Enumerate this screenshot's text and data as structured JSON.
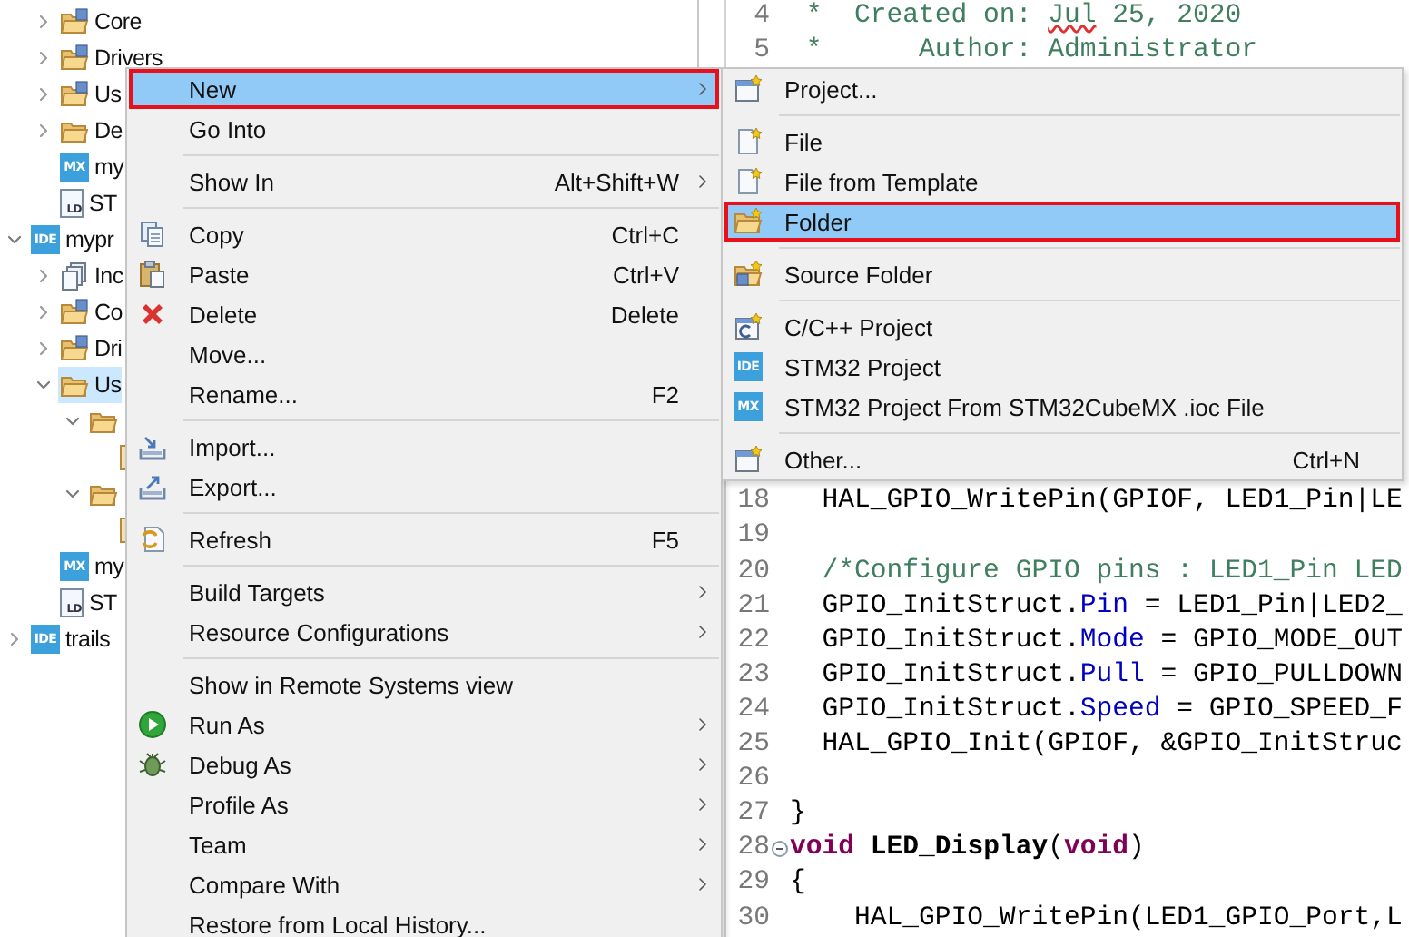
{
  "explorer": {
    "tree": [
      {
        "kind": "group",
        "children": [
          {
            "label": "Core",
            "kind": "source-folder",
            "expanded": false,
            "selected": false
          },
          {
            "label": "Drivers",
            "kind": "source-folder",
            "expanded": false,
            "selected": false
          },
          {
            "label": "Us",
            "kind": "source-folder",
            "expanded": false,
            "selected": false
          },
          {
            "label": "De",
            "kind": "folder",
            "expanded": false,
            "selected": false
          },
          {
            "label": "my",
            "kind": "badge-file",
            "badge": "MX",
            "selected": false
          },
          {
            "label": "ST",
            "kind": "linker-file",
            "badge": "LD",
            "selected": false
          }
        ]
      },
      {
        "label": "mypr",
        "kind": "project",
        "badge": "IDE",
        "expanded": true,
        "selected": false,
        "children": [
          {
            "label": "Inc",
            "kind": "include",
            "expanded": false,
            "selected": false
          },
          {
            "label": "Co",
            "kind": "source-folder",
            "expanded": false,
            "selected": false
          },
          {
            "label": "Dri",
            "kind": "source-folder",
            "expanded": false,
            "selected": false
          },
          {
            "label": "Us",
            "kind": "folder",
            "expanded": true,
            "selected": true,
            "children": [
              {
                "kind": "folder",
                "expanded": true,
                "selected": false,
                "children": [
                  {
                    "kind": "file",
                    "selected": false
                  }
                ]
              },
              {
                "kind": "folder",
                "expanded": true,
                "selected": false,
                "children": [
                  {
                    "kind": "file",
                    "selected": false
                  }
                ]
              }
            ]
          },
          {
            "label": "my",
            "kind": "badge-file",
            "badge": "MX",
            "selected": false
          },
          {
            "label": "ST",
            "kind": "linker-file",
            "badge": "LD",
            "selected": false
          }
        ]
      },
      {
        "label": "trails",
        "kind": "project",
        "badge": "IDE",
        "expanded": false,
        "selected": false
      }
    ]
  },
  "editor": {
    "blocks": [
      {
        "lines": [
          {
            "number": "4",
            "foldable": false,
            "segments": [
              {
                "text": " *  Created on: ",
                "kind": "comment"
              },
              {
                "text": "Jul",
                "kind": "misspelled"
              },
              {
                "text": " 25, 2020",
                "kind": "comment"
              }
            ]
          },
          {
            "number": "5",
            "foldable": false,
            "segments": [
              {
                "text": " *      Author: Administrator",
                "kind": "comment"
              }
            ]
          }
        ]
      },
      {
        "lines": [
          {
            "number": "18",
            "foldable": false,
            "segments": [
              {
                "text": "  HAL_GPIO_WritePin(GPIOF, LED1_Pin|LE",
                "kind": "plain"
              }
            ]
          },
          {
            "number": "19",
            "foldable": false
          },
          {
            "number": "20",
            "foldable": false,
            "segments": [
              {
                "text": "  /*Configure GPIO pins : LED1_Pin LED",
                "kind": "comment"
              }
            ]
          },
          {
            "number": "21",
            "foldable": false,
            "segments": [
              {
                "text": "  GPIO_InitStruct.",
                "kind": "plain"
              },
              {
                "text": "Pin",
                "kind": "field"
              },
              {
                "text": " = LED1_Pin|LED2_",
                "kind": "plain"
              }
            ]
          },
          {
            "number": "22",
            "foldable": false,
            "segments": [
              {
                "text": "  GPIO_InitStruct.",
                "kind": "plain"
              },
              {
                "text": "Mode",
                "kind": "field"
              },
              {
                "text": " = GPIO_MODE_OUT",
                "kind": "plain"
              }
            ]
          },
          {
            "number": "23",
            "foldable": false,
            "segments": [
              {
                "text": "  GPIO_InitStruct.",
                "kind": "plain"
              },
              {
                "text": "Pull",
                "kind": "field"
              },
              {
                "text": " = GPIO_PULLDOWN",
                "kind": "plain"
              }
            ]
          },
          {
            "number": "24",
            "foldable": false,
            "segments": [
              {
                "text": "  GPIO_InitStruct.",
                "kind": "plain"
              },
              {
                "text": "Speed",
                "kind": "field"
              },
              {
                "text": " = GPIO_SPEED_F",
                "kind": "plain"
              }
            ]
          },
          {
            "number": "25",
            "foldable": false,
            "segments": [
              {
                "text": "  HAL_GPIO_Init(GPIOF, &GPIO_InitStruc",
                "kind": "plain"
              }
            ]
          },
          {
            "number": "26",
            "foldable": false
          },
          {
            "number": "27",
            "foldable": false,
            "segments": [
              {
                "text": "}",
                "kind": "plain"
              }
            ]
          },
          {
            "number": "28",
            "foldable": true,
            "segments": [
              {
                "text": "void",
                "kind": "keyword"
              },
              {
                "text": " LED_Display",
                "kind": "declaration"
              },
              {
                "text": "(",
                "kind": "plain"
              },
              {
                "text": "void",
                "kind": "keyword"
              },
              {
                "text": ")",
                "kind": "plain"
              }
            ]
          },
          {
            "number": "29",
            "foldable": false,
            "segments": [
              {
                "text": "{",
                "kind": "plain"
              }
            ]
          },
          {
            "number": "30",
            "foldable": false,
            "segments": [
              {
                "text": "    HAL_GPIO_WritePin(LED1_GPIO_Port,L",
                "kind": "plain"
              }
            ]
          }
        ]
      }
    ]
  },
  "context_menu": {
    "items": [
      {
        "kind": "item",
        "label": "New",
        "submenu": true,
        "selected": true,
        "outlined": true
      },
      {
        "kind": "item",
        "label": "Go Into",
        "submenu": false,
        "selected": false,
        "outlined": false
      },
      {
        "kind": "separator"
      },
      {
        "kind": "item",
        "label": "Show In",
        "shortcut": "Alt+Shift+W",
        "submenu": true,
        "selected": false,
        "outlined": false
      },
      {
        "kind": "separator"
      },
      {
        "kind": "item",
        "label": "Copy",
        "shortcut": "Ctrl+C",
        "submenu": false,
        "selected": false,
        "outlined": false
      },
      {
        "kind": "item",
        "label": "Paste",
        "shortcut": "Ctrl+V",
        "submenu": false,
        "selected": false,
        "outlined": false
      },
      {
        "kind": "item",
        "label": "Delete",
        "shortcut": "Delete",
        "submenu": false,
        "selected": false,
        "outlined": false
      },
      {
        "kind": "item",
        "label": "Move...",
        "submenu": false,
        "selected": false,
        "outlined": false
      },
      {
        "kind": "item",
        "label": "Rename...",
        "shortcut": "F2",
        "submenu": false,
        "selected": false,
        "outlined": false
      },
      {
        "kind": "separator"
      },
      {
        "kind": "item",
        "label": "Import...",
        "submenu": false,
        "selected": false,
        "outlined": false
      },
      {
        "kind": "item",
        "label": "Export...",
        "submenu": false,
        "selected": false,
        "outlined": false
      },
      {
        "kind": "separator"
      },
      {
        "kind": "item",
        "label": "Refresh",
        "shortcut": "F5",
        "submenu": false,
        "selected": false,
        "outlined": false
      },
      {
        "kind": "separator"
      },
      {
        "kind": "item",
        "label": "Build Targets",
        "submenu": true,
        "selected": false,
        "outlined": false
      },
      {
        "kind": "item",
        "label": "Resource Configurations",
        "submenu": true,
        "selected": false,
        "outlined": false
      },
      {
        "kind": "separator"
      },
      {
        "kind": "item",
        "label": "Show in Remote Systems view",
        "submenu": false,
        "selected": false,
        "outlined": false
      },
      {
        "kind": "item",
        "label": "Run As",
        "submenu": true,
        "selected": false,
        "outlined": false
      },
      {
        "kind": "item",
        "label": "Debug As",
        "submenu": true,
        "selected": false,
        "outlined": false
      },
      {
        "kind": "item",
        "label": "Profile As",
        "submenu": true,
        "selected": false,
        "outlined": false
      },
      {
        "kind": "item",
        "label": "Team",
        "submenu": true,
        "selected": false,
        "outlined": false
      },
      {
        "kind": "item",
        "label": "Compare With",
        "submenu": true,
        "selected": false,
        "outlined": false
      },
      {
        "kind": "item",
        "label": "Restore from Local History...",
        "submenu": false,
        "selected": false,
        "outlined": false
      }
    ]
  },
  "new_submenu": {
    "items": [
      {
        "kind": "item",
        "label": "Project...",
        "submenu": false,
        "selected": false,
        "outlined": false
      },
      {
        "kind": "separator"
      },
      {
        "kind": "item",
        "label": "File",
        "submenu": false,
        "selected": false,
        "outlined": false
      },
      {
        "kind": "item",
        "label": "File from Template",
        "submenu": false,
        "selected": false,
        "outlined": false
      },
      {
        "kind": "item",
        "label": "Folder",
        "submenu": false,
        "selected": true,
        "outlined": true
      },
      {
        "kind": "separator"
      },
      {
        "kind": "item",
        "label": "Source Folder",
        "submenu": false,
        "selected": false,
        "outlined": false
      },
      {
        "kind": "separator"
      },
      {
        "kind": "item",
        "label": "C/C++ Project",
        "submenu": false,
        "selected": false,
        "outlined": false
      },
      {
        "kind": "item",
        "label": "STM32 Project",
        "badge": "IDE",
        "submenu": false,
        "selected": false,
        "outlined": false
      },
      {
        "kind": "item",
        "label": "STM32 Project From STM32CubeMX .ioc File",
        "badge": "MX",
        "submenu": false,
        "selected": false,
        "outlined": false
      },
      {
        "kind": "separator"
      },
      {
        "kind": "item",
        "label": "Other...",
        "shortcut": "Ctrl+N",
        "submenu": false,
        "selected": false,
        "outlined": false
      }
    ]
  }
}
